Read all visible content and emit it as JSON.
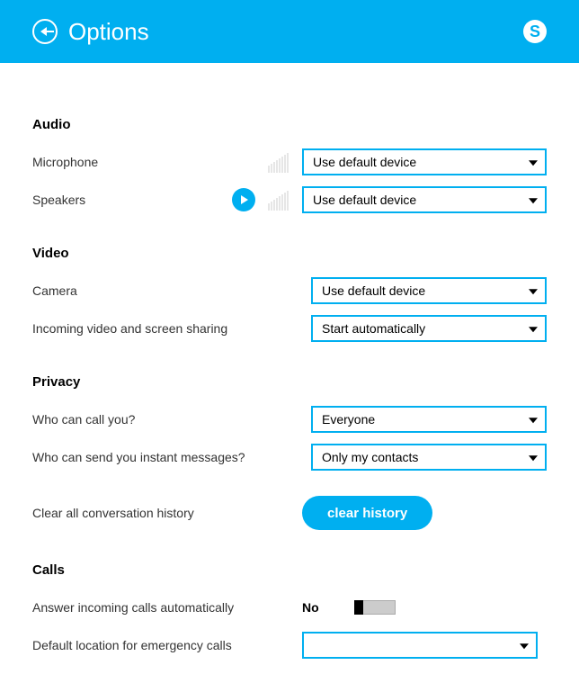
{
  "header": {
    "title": "Options"
  },
  "sections": {
    "audio": {
      "title": "Audio",
      "microphone_label": "Microphone",
      "microphone_value": "Use default device",
      "speakers_label": "Speakers",
      "speakers_value": "Use default device"
    },
    "video": {
      "title": "Video",
      "camera_label": "Camera",
      "camera_value": "Use default device",
      "incoming_label": "Incoming video and screen sharing",
      "incoming_value": "Start automatically"
    },
    "privacy": {
      "title": "Privacy",
      "who_call_label": "Who can call you?",
      "who_call_value": "Everyone",
      "who_im_label": "Who can send you instant messages?",
      "who_im_value": "Only my contacts",
      "clear_history_label": "Clear all conversation history",
      "clear_history_button": "clear history"
    },
    "calls": {
      "title": "Calls",
      "auto_answer_label": "Answer incoming calls automatically",
      "auto_answer_value": "No",
      "emergency_label": "Default location for emergency calls",
      "emergency_value": ""
    }
  }
}
